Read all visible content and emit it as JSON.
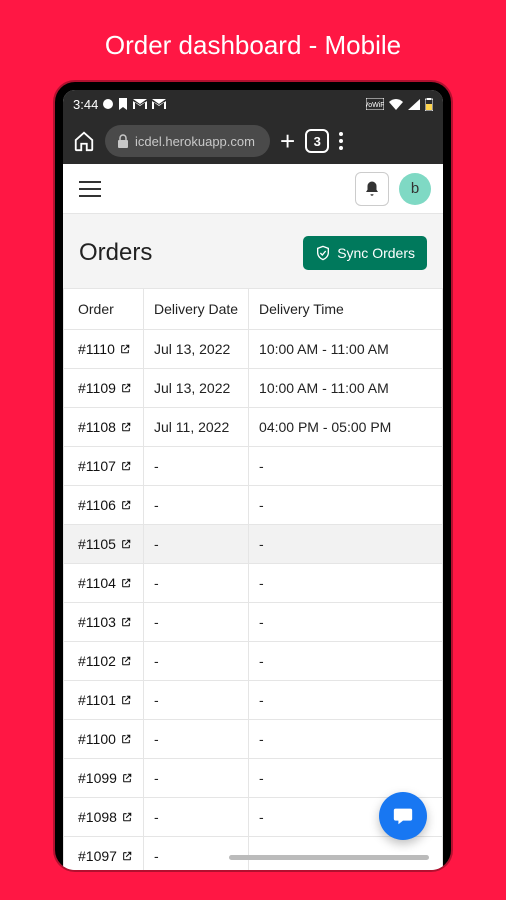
{
  "page": {
    "caption": "Order dashboard - Mobile"
  },
  "status": {
    "time": "3:44"
  },
  "browser": {
    "url": "icdel.herokuapp.com",
    "tab_count": "3"
  },
  "appheader": {
    "avatar_initial": "b"
  },
  "content": {
    "title": "Orders",
    "sync_label": "Sync Orders",
    "columns": {
      "order": "Order",
      "date": "Delivery Date",
      "time": "Delivery Time"
    }
  },
  "orders": [
    {
      "id": "#1110",
      "date": "Jul 13, 2022",
      "time": "10:00 AM - 11:00 AM"
    },
    {
      "id": "#1109",
      "date": "Jul 13, 2022",
      "time": "10:00 AM - 11:00 AM"
    },
    {
      "id": "#1108",
      "date": "Jul 11, 2022",
      "time": "04:00 PM - 05:00 PM"
    },
    {
      "id": "#1107",
      "date": "-",
      "time": "-"
    },
    {
      "id": "#1106",
      "date": "-",
      "time": "-"
    },
    {
      "id": "#1105",
      "date": "-",
      "time": "-",
      "hover": true
    },
    {
      "id": "#1104",
      "date": "-",
      "time": "-"
    },
    {
      "id": "#1103",
      "date": "-",
      "time": "-"
    },
    {
      "id": "#1102",
      "date": "-",
      "time": "-"
    },
    {
      "id": "#1101",
      "date": "-",
      "time": "-"
    },
    {
      "id": "#1100",
      "date": "-",
      "time": "-"
    },
    {
      "id": "#1099",
      "date": "-",
      "time": "-"
    },
    {
      "id": "#1098",
      "date": "-",
      "time": "-"
    },
    {
      "id": "#1097",
      "date": "-",
      "time": "-"
    }
  ]
}
